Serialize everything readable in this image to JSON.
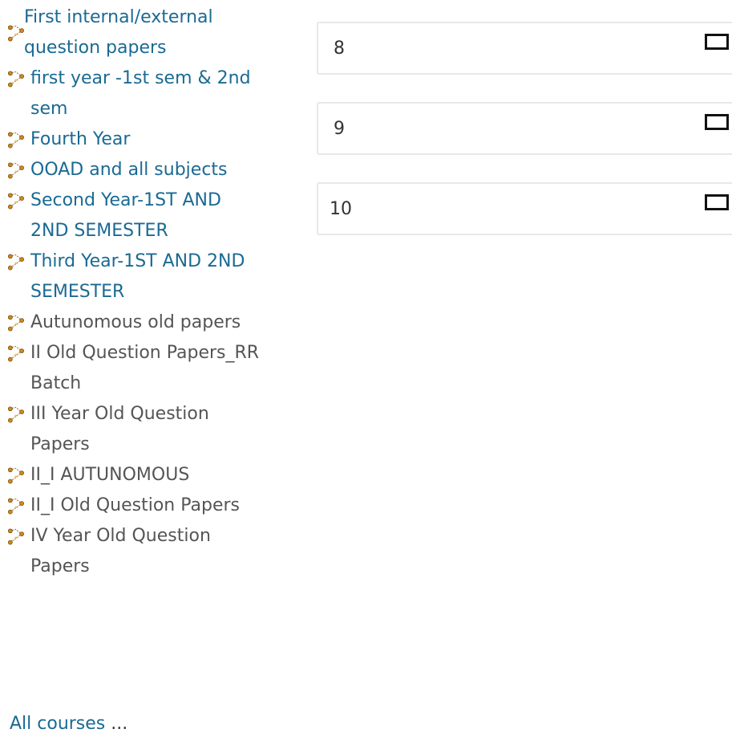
{
  "courses": [
    {
      "label": "First internal/external question papers",
      "state": "visible"
    },
    {
      "label": "first year -1st sem & 2nd sem",
      "state": "visible"
    },
    {
      "label": "Fourth Year",
      "state": "visible"
    },
    {
      "label": "OOAD and all subjects",
      "state": "visible"
    },
    {
      "label": "Second Year-1ST AND 2ND SEMESTER",
      "state": "visible"
    },
    {
      "label": "Third Year-1ST AND 2ND SEMESTER",
      "state": "visible"
    },
    {
      "label": "Autunomous old papers",
      "state": "dimmed"
    },
    {
      "label": "II Old Question Papers_RR Batch",
      "state": "dimmed"
    },
    {
      "label": "III Year Old Question Papers",
      "state": "dimmed"
    },
    {
      "label": "II_I AUTUNOMOUS",
      "state": "dimmed"
    },
    {
      "label": "II_I Old Question Papers",
      "state": "dimmed"
    },
    {
      "label": "IV Year Old Question Papers",
      "state": "dimmed"
    }
  ],
  "course_icon": "course-category-icon",
  "all_courses": {
    "label": "All courses",
    "suffix": "..."
  },
  "questions": [
    {
      "number": "8",
      "flag_icon": "flag-checkbox-icon"
    },
    {
      "number": "9",
      "flag_icon": "flag-checkbox-icon"
    },
    {
      "number": "10",
      "flag_icon": "flag-checkbox-icon"
    }
  ],
  "colors": {
    "link": "#1a6a93",
    "dimmed": "#555555",
    "box_border": "#e8e8e8"
  }
}
